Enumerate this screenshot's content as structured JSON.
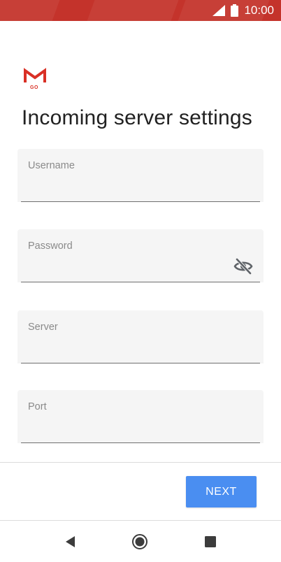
{
  "status_bar": {
    "time": "10:00",
    "icons": [
      "signal-icon",
      "battery-icon"
    ],
    "color": "#c4332b"
  },
  "app": {
    "logo_text": "GO",
    "logo_icon": "gmail-go-logo"
  },
  "page": {
    "title": "Incoming server settings"
  },
  "form": {
    "username": {
      "label": "Username",
      "value": ""
    },
    "password": {
      "label": "Password",
      "value": "",
      "toggle_icon": "visibility-off-icon"
    },
    "server": {
      "label": "Server",
      "value": ""
    },
    "port": {
      "label": "Port",
      "value": ""
    }
  },
  "actions": {
    "next_label": "NEXT",
    "accent": "#4a8ef1"
  },
  "nav": {
    "icons": [
      "back-icon",
      "home-icon",
      "recents-icon"
    ]
  }
}
